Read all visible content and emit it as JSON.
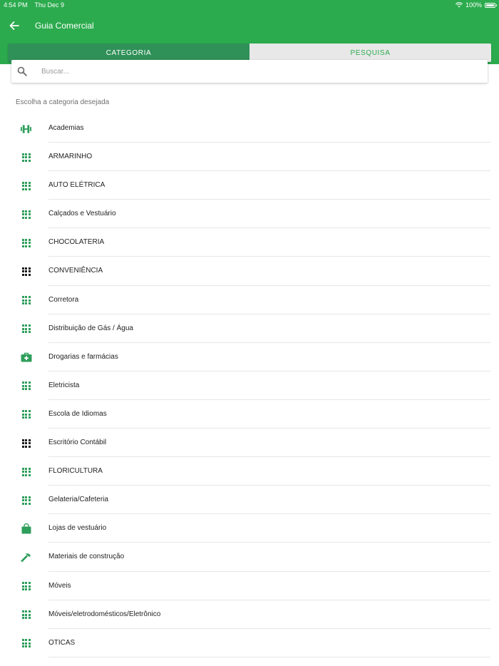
{
  "status_bar": {
    "time": "4:54 PM",
    "date": "Thu Dec 9",
    "battery_text": "100%",
    "battery_level": 1.0,
    "wifi_icon": "wifi-icon",
    "battery_icon": "battery-icon"
  },
  "header": {
    "title": "Guia Comercial",
    "back_icon": "arrow-left-icon"
  },
  "tabs": [
    {
      "label": "CATEGORIA",
      "active": true
    },
    {
      "label": "PESQUISA",
      "active": false
    }
  ],
  "search": {
    "placeholder": "Buscar...",
    "value": "",
    "icon": "search-icon"
  },
  "section_label": "Escolha a categoria desejada",
  "colors": {
    "brand_green": "#2cab4e",
    "active_tab": "#2f9158",
    "icon_green": "#2e9e5b",
    "icon_dark": "#1a1a1a"
  },
  "categories": [
    {
      "label": "Academias",
      "icon": "dumbbell-icon",
      "icon_color": "green"
    },
    {
      "label": "ARMARINHO",
      "icon": "grid-icon",
      "icon_color": "green"
    },
    {
      "label": "AUTO ELÉTRICA",
      "icon": "grid-icon",
      "icon_color": "green"
    },
    {
      "label": "Calçados e Vestuário",
      "icon": "grid-icon",
      "icon_color": "green"
    },
    {
      "label": "CHOCOLATERIA",
      "icon": "grid-icon",
      "icon_color": "green"
    },
    {
      "label": "CONVENIÊNCIA",
      "icon": "grid-icon",
      "icon_color": "dark"
    },
    {
      "label": "Corretora",
      "icon": "grid-icon",
      "icon_color": "green"
    },
    {
      "label": "Distribuição de Gás / Água",
      "icon": "grid-icon",
      "icon_color": "green"
    },
    {
      "label": "Drogarias e farmácias",
      "icon": "medical-kit-icon",
      "icon_color": "green"
    },
    {
      "label": "Eletricista",
      "icon": "grid-icon",
      "icon_color": "green"
    },
    {
      "label": "Escola de Idiomas",
      "icon": "grid-icon",
      "icon_color": "green"
    },
    {
      "label": "Escritório Contábil",
      "icon": "grid-icon",
      "icon_color": "dark"
    },
    {
      "label": "FLORICULTURA",
      "icon": "grid-icon",
      "icon_color": "green"
    },
    {
      "label": "Gelateria/Cafeteria",
      "icon": "grid-icon",
      "icon_color": "green"
    },
    {
      "label": "Lojas de vestuário",
      "icon": "shopping-bag-icon",
      "icon_color": "green"
    },
    {
      "label": "Materiais de construção",
      "icon": "hammer-icon",
      "icon_color": "green"
    },
    {
      "label": "Móveis",
      "icon": "grid-icon",
      "icon_color": "green"
    },
    {
      "label": "Móveis/eletrodomésticos/Eletrônico",
      "icon": "grid-icon",
      "icon_color": "green"
    },
    {
      "label": "OTICAS",
      "icon": "grid-icon",
      "icon_color": "green"
    }
  ]
}
